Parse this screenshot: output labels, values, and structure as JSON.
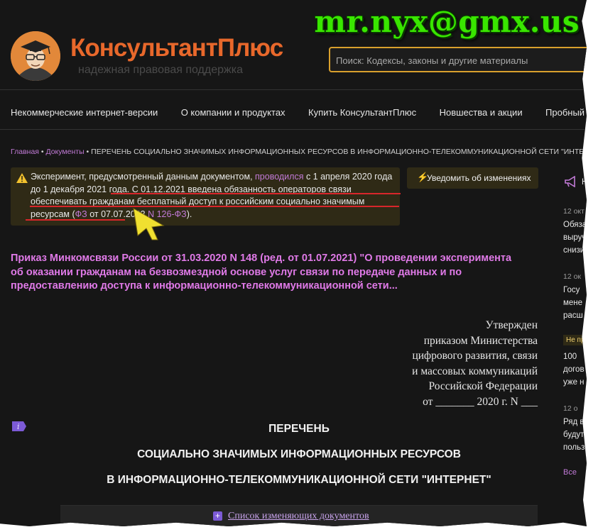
{
  "watermark": "mr.nyx@gmx.us",
  "header": {
    "brand": "КонсультантПлюс",
    "tagline": "надежная правовая поддержка",
    "search_placeholder": "Поиск: Кодексы, законы и другие материалы"
  },
  "nav": [
    "Некоммерческие интернет-версии",
    "О компании и продуктах",
    "Купить КонсультантПлюс",
    "Новшества и акции",
    "Пробный до"
  ],
  "breadcrumb": {
    "home": "Главная",
    "sep": " • ",
    "docs": "Документы",
    "current": "ПЕРЕЧЕНЬ СОЦИАЛЬНО ЗНАЧИМЫХ ИНФОРМАЦИОННЫХ РЕСУРСОВ В ИНФОРМАЦИОННО-ТЕЛЕКОММУНИКАЦИОННОЙ СЕТИ \"ИНТЕРНЕТ\""
  },
  "notice": {
    "p1": "Эксперимент, предусмотренный данным документом, ",
    "link1": "проводился",
    "p2": " с 1 апреля 2020 года до 1 декабря 2021 года. С 01.12.2021 введена обязанность операторов связи обеспечивать гражданам бесплатный доступ к российским социально значимым ресурсам (",
    "link2": "ФЗ",
    "p3": " от 07.07.2003 ",
    "link3": "N 126-ФЗ",
    "p4": ")."
  },
  "notify_label": "Уведомить об изменениях",
  "order_title": "Приказ Минкомсвязи России от 31.03.2020 N 148 (ред. от 01.07.2021) \"О проведении эксперимента об оказании гражданам на безвозмездной основе услуг связи по передаче данных и по предоставлению доступа к информационно-телекоммуникационной сети...",
  "approved": [
    "Утвержден",
    "приказом Министерства",
    "цифрового развития, связи",
    "и массовых коммуникаций",
    "Российской Федерации",
    "от _______ 2020 г. N ___"
  ],
  "info_badge": "i",
  "doc_headings": [
    "ПЕРЕЧЕНЬ",
    "СОЦИАЛЬНО ЗНАЧИМЫХ ИНФОРМАЦИОННЫХ РЕСУРСОВ",
    "В ИНФОРМАЦИОННО-ТЕЛЕКОММУНИКАЦИОННОЙ СЕТИ \"ИНТЕРНЕТ\""
  ],
  "list_bar": {
    "plus": "+",
    "label": "Список изменяющих документов"
  },
  "sidebar": {
    "title": "Н",
    "date1": "12 окт",
    "news1": [
      "Обяза",
      "выруч",
      "снизи"
    ],
    "date2": "12 ок",
    "news2": [
      "Госу",
      "мене",
      "расш"
    ],
    "badge": "Не пр",
    "news3": [
      "100 ",
      "догов",
      "уже н"
    ],
    "date3": "12 о",
    "news4": [
      "Ряд в",
      "будут",
      "польз"
    ],
    "all": "Все"
  },
  "colors": {
    "brand": "#e8682b",
    "accent": "#c17ad6",
    "title": "#e07ae8",
    "search_border": "#d9a02d",
    "email": "#39e600"
  }
}
